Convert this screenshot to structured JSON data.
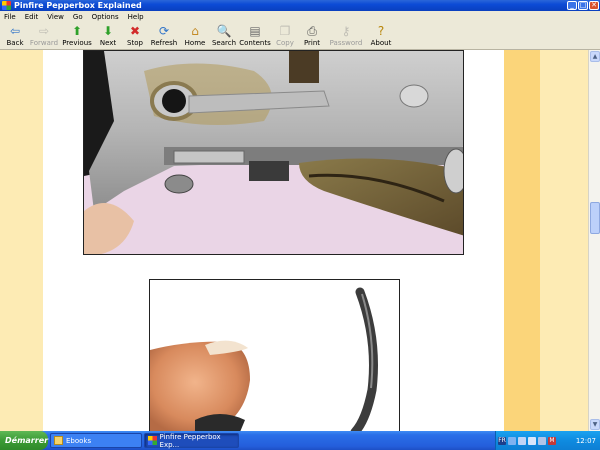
{
  "window": {
    "title": "Pinfire Pepperbox Explained",
    "controls": {
      "minimize": "_",
      "maximize": "□",
      "close": "✕"
    }
  },
  "menu": [
    "File",
    "Edit",
    "View",
    "Go",
    "Options",
    "Help"
  ],
  "toolbar": [
    {
      "label": "Back",
      "icon": "back-arrow-icon",
      "glyph": "⇦",
      "color": "#2f73c8",
      "enabled": true
    },
    {
      "label": "Forward",
      "icon": "forward-arrow-icon",
      "glyph": "⇨",
      "color": "#8a8a8a",
      "enabled": false
    },
    {
      "label": "Previous",
      "icon": "previous-up-arrow-icon",
      "glyph": "⬆",
      "color": "#2fa12a",
      "enabled": true
    },
    {
      "label": "Next",
      "icon": "next-down-arrow-icon",
      "glyph": "⬇",
      "color": "#2fa12a",
      "enabled": true
    },
    {
      "label": "Stop",
      "icon": "stop-icon",
      "glyph": "✖",
      "color": "#d22b2b",
      "enabled": true
    },
    {
      "label": "Refresh",
      "icon": "refresh-icon",
      "glyph": "⟳",
      "color": "#2f73c8",
      "enabled": true
    },
    {
      "label": "Home",
      "icon": "home-icon",
      "glyph": "⌂",
      "color": "#c38a24",
      "enabled": true
    },
    {
      "label": "Search",
      "icon": "search-icon",
      "glyph": "🔍",
      "color": "#555555",
      "enabled": true
    },
    {
      "label": "Contents",
      "icon": "contents-icon",
      "glyph": "▤",
      "color": "#6a6a6a",
      "enabled": true
    },
    {
      "label": "Copy",
      "icon": "copy-icon",
      "glyph": "❐",
      "color": "#8a8a8a",
      "enabled": false
    },
    {
      "label": "Print",
      "icon": "print-icon",
      "glyph": "⎙",
      "color": "#555555",
      "enabled": true
    },
    {
      "label": "Password",
      "icon": "key-icon",
      "glyph": "⚷",
      "color": "#8a8a8a",
      "enabled": false
    },
    {
      "label": "About",
      "icon": "about-icon",
      "glyph": "?",
      "color": "#b8860b",
      "enabled": true
    }
  ],
  "colors": {
    "page_background": "#ffffff",
    "left_strip": "#fdebb4",
    "right_strip_dark": "#fbd57a",
    "right_strip_light": "#fdebb4",
    "photo_background": "#ebd6e7"
  },
  "images": [
    {
      "description_name": "pepperbox-mechanism-closeup"
    },
    {
      "description_name": "fingertip-holding-wire-spring"
    }
  ],
  "taskbar": {
    "start_label": "Démarrer",
    "tasks": [
      {
        "label": "Ebooks"
      },
      {
        "label": "Pinfire Pepperbox Exp..."
      }
    ],
    "clock": "12:07"
  }
}
